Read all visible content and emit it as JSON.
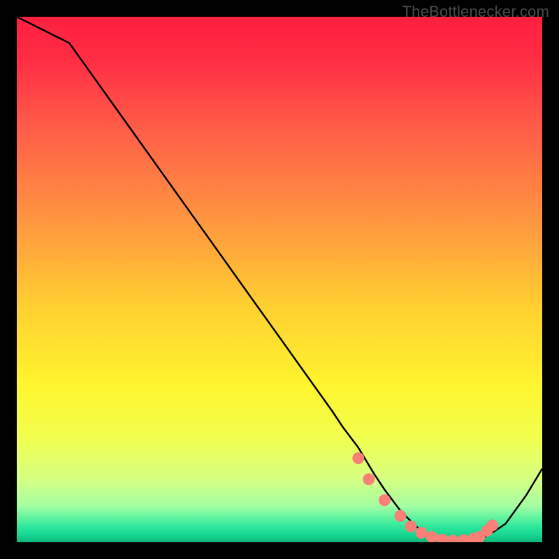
{
  "watermark": "TheBottlenecker.com",
  "chart_data": {
    "type": "line",
    "title": "",
    "xlabel": "",
    "ylabel": "",
    "xlim": [
      0,
      100
    ],
    "ylim": [
      0,
      100
    ],
    "x": [
      0,
      6,
      10,
      15,
      20,
      25,
      30,
      35,
      40,
      45,
      50,
      55,
      60,
      62,
      65,
      68,
      70,
      73,
      76,
      78,
      80,
      82,
      84,
      86,
      88,
      90,
      93,
      97,
      100
    ],
    "values": [
      100,
      97,
      95,
      88,
      81,
      74,
      67,
      60,
      53,
      46,
      39,
      32,
      25,
      22,
      18,
      13,
      10,
      6,
      3,
      1.5,
      0.8,
      0.4,
      0.3,
      0.3,
      0.5,
      1.5,
      3.5,
      9,
      14
    ],
    "dots": {
      "x": [
        65,
        67,
        70,
        73,
        75,
        77,
        79,
        81,
        83,
        85,
        87,
        88,
        89.5,
        90.5
      ],
      "y": [
        16,
        12,
        8,
        5,
        3,
        1.8,
        1.0,
        0.5,
        0.3,
        0.4,
        0.7,
        1.0,
        2.2,
        3.2
      ]
    },
    "dot_color": "#f97f77",
    "curve_color": "#000000",
    "curve_width": 2.5,
    "gradient_stops": [
      {
        "offset": 0.0,
        "color": "#ff203f"
      },
      {
        "offset": 0.08,
        "color": "#ff2d44"
      },
      {
        "offset": 0.22,
        "color": "#ff6048"
      },
      {
        "offset": 0.4,
        "color": "#ff9a3f"
      },
      {
        "offset": 0.55,
        "color": "#ffcf30"
      },
      {
        "offset": 0.7,
        "color": "#fff52e"
      },
      {
        "offset": 0.8,
        "color": "#f2ff4e"
      },
      {
        "offset": 0.88,
        "color": "#d6ff82"
      },
      {
        "offset": 0.93,
        "color": "#a6ffa3"
      },
      {
        "offset": 0.955,
        "color": "#5cf2a0"
      },
      {
        "offset": 0.97,
        "color": "#2fe79c"
      },
      {
        "offset": 0.985,
        "color": "#18d893"
      },
      {
        "offset": 1.0,
        "color": "#0bb877"
      }
    ]
  }
}
